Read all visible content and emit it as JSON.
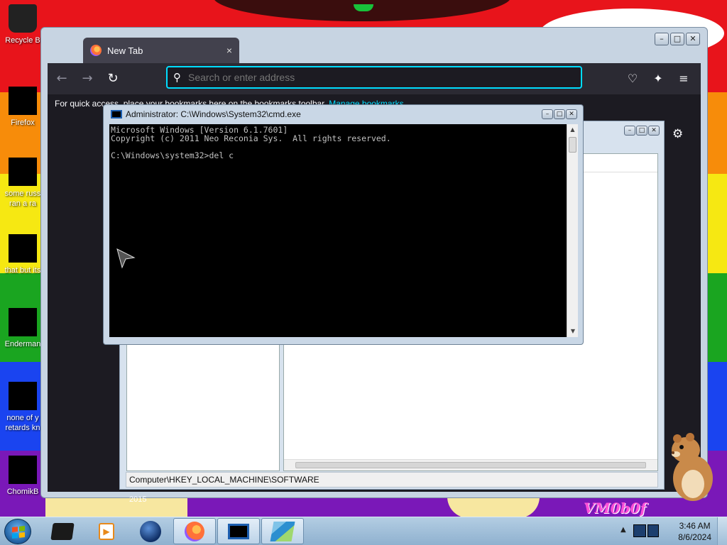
{
  "desktop": {
    "icons": [
      {
        "label": "Recycle B"
      },
      {
        "label": "Firefox"
      },
      {
        "label": "some russ ran a ra"
      },
      {
        "label": "that but its"
      },
      {
        "label": "Enderman"
      },
      {
        "label": "none of y retards kn"
      },
      {
        "label": "ChomikB"
      }
    ],
    "wallpaper_text": "VM0b0f",
    "wallpaper_year": "2015",
    "colors": {
      "red": "#e8141b",
      "orange": "#f78c0a",
      "yellow": "#f6e812",
      "green": "#1aa520",
      "blue": "#1a44f0",
      "purple": "#7a18b8"
    }
  },
  "firefox": {
    "tab_title": "New Tab",
    "tab_close": "×",
    "url_placeholder": "Search or enter address",
    "bookmarks_text": "For quick access, place your bookmarks here on the bookmarks toolbar.",
    "bookmarks_link": "Manage bookmarks",
    "icons": [
      "back-icon",
      "forward-icon",
      "reload-icon",
      "search-icon",
      "pocket-icon",
      "extensions-icon",
      "menu-icon",
      "gear-icon"
    ]
  },
  "cmd": {
    "title": "Administrator: C:\\Windows\\System32\\cmd.exe",
    "console": "Microsoft Windows [Version 6.1.7601]\nCopyright (c) 2011 Neo Reconia Sys.  All rights reserved.\n\nC:\\Windows\\system32>del c"
  },
  "regedit": {
    "status": "Computer\\HKEY_LOCAL_MACHINE\\SOFTWARE"
  },
  "taskbar": {
    "time": "3:46 AM",
    "date": "8/6/2024",
    "items": [
      "explorer-icon",
      "media-player-icon",
      "browser-globe-icon",
      "firefox-icon",
      "cmd-icon",
      "regedit-icon"
    ]
  }
}
